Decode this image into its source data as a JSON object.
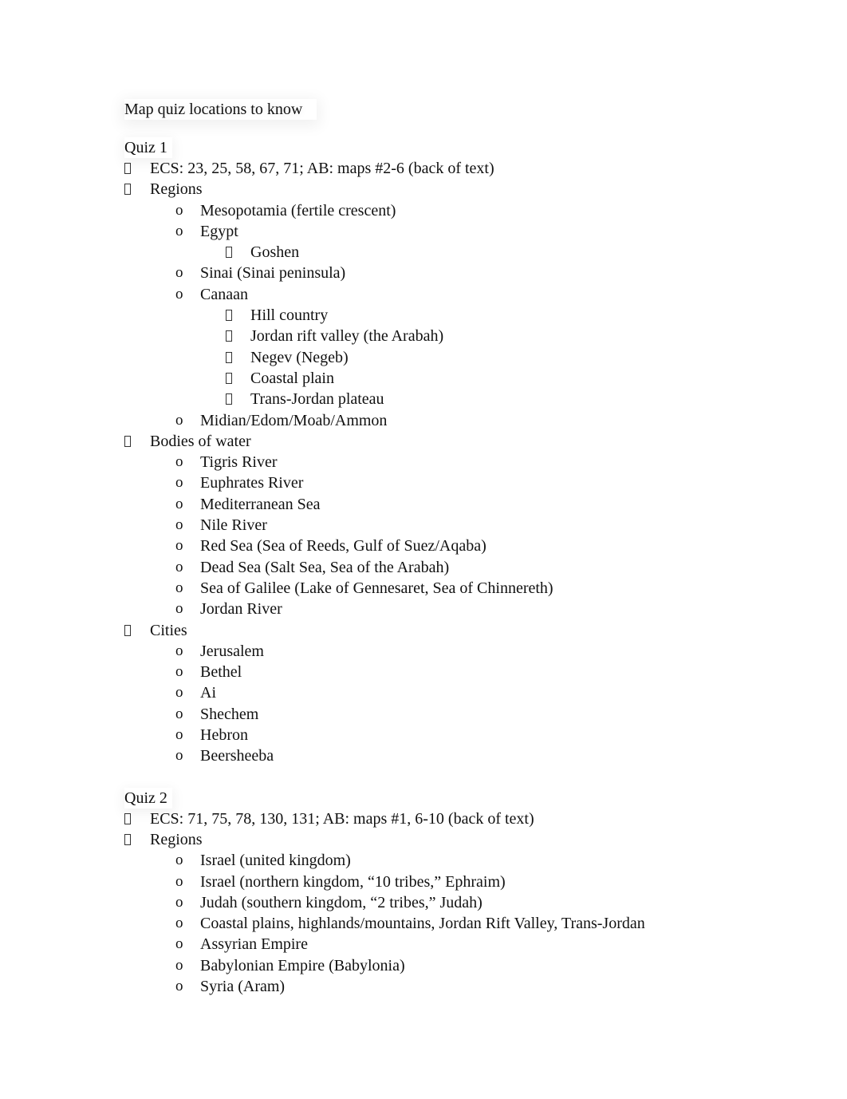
{
  "document": {
    "title": "Map quiz locations to know",
    "bullet_glyphs": {
      "level1": "missing-glyph-box",
      "level2": "o",
      "level3": "missing-glyph-box"
    },
    "quizzes": [
      {
        "heading": "Quiz 1",
        "items": [
          {
            "level": 1,
            "text": "ECS: 23, 25, 58, 67, 71; AB: maps #2-6 (back of text)"
          },
          {
            "level": 1,
            "text": "Regions"
          },
          {
            "level": 2,
            "text": "Mesopotamia (fertile crescent)"
          },
          {
            "level": 2,
            "text": "Egypt"
          },
          {
            "level": 3,
            "text": "Goshen"
          },
          {
            "level": 2,
            "text": "Sinai (Sinai peninsula)"
          },
          {
            "level": 2,
            "text": "Canaan"
          },
          {
            "level": 3,
            "text": "Hill country"
          },
          {
            "level": 3,
            "text": "Jordan rift valley (the Arabah)"
          },
          {
            "level": 3,
            "text": "Negev (Negeb)"
          },
          {
            "level": 3,
            "text": "Coastal plain"
          },
          {
            "level": 3,
            "text": "Trans-Jordan plateau"
          },
          {
            "level": 2,
            "text": "Midian/Edom/Moab/Ammon"
          },
          {
            "level": 1,
            "text": "Bodies of water"
          },
          {
            "level": 2,
            "text": "Tigris River"
          },
          {
            "level": 2,
            "text": "Euphrates River"
          },
          {
            "level": 2,
            "text": "Mediterranean Sea"
          },
          {
            "level": 2,
            "text": "Nile River"
          },
          {
            "level": 2,
            "text": "Red Sea (Sea of Reeds, Gulf of Suez/Aqaba)"
          },
          {
            "level": 2,
            "text": "Dead Sea (Salt Sea, Sea of the Arabah)"
          },
          {
            "level": 2,
            "text": "Sea of Galilee (Lake of Gennesaret, Sea of Chinnereth)"
          },
          {
            "level": 2,
            "text": "Jordan River"
          },
          {
            "level": 1,
            "text": "Cities"
          },
          {
            "level": 2,
            "text": "Jerusalem"
          },
          {
            "level": 2,
            "text": "Bethel"
          },
          {
            "level": 2,
            "text": "Ai"
          },
          {
            "level": 2,
            "text": "Shechem"
          },
          {
            "level": 2,
            "text": "Hebron"
          },
          {
            "level": 2,
            "text": "Beersheeba"
          }
        ]
      },
      {
        "heading": "Quiz 2",
        "items": [
          {
            "level": 1,
            "text": "ECS: 71, 75, 78, 130, 131; AB: maps #1, 6-10 (back of text)"
          },
          {
            "level": 1,
            "text": "Regions"
          },
          {
            "level": 2,
            "text": "Israel (united kingdom)"
          },
          {
            "level": 2,
            "text": "Israel (northern kingdom, “10 tribes,” Ephraim)"
          },
          {
            "level": 2,
            "text": "Judah (southern kingdom, “2 tribes,” Judah)"
          },
          {
            "level": 2,
            "text": "Coastal plains, highlands/mountains, Jordan Rift Valley, Trans-Jordan"
          },
          {
            "level": 2,
            "text": "Assyrian Empire"
          },
          {
            "level": 2,
            "text": "Babylonian Empire (Babylonia)"
          },
          {
            "level": 2,
            "text": "Syria (Aram)"
          }
        ]
      }
    ]
  }
}
